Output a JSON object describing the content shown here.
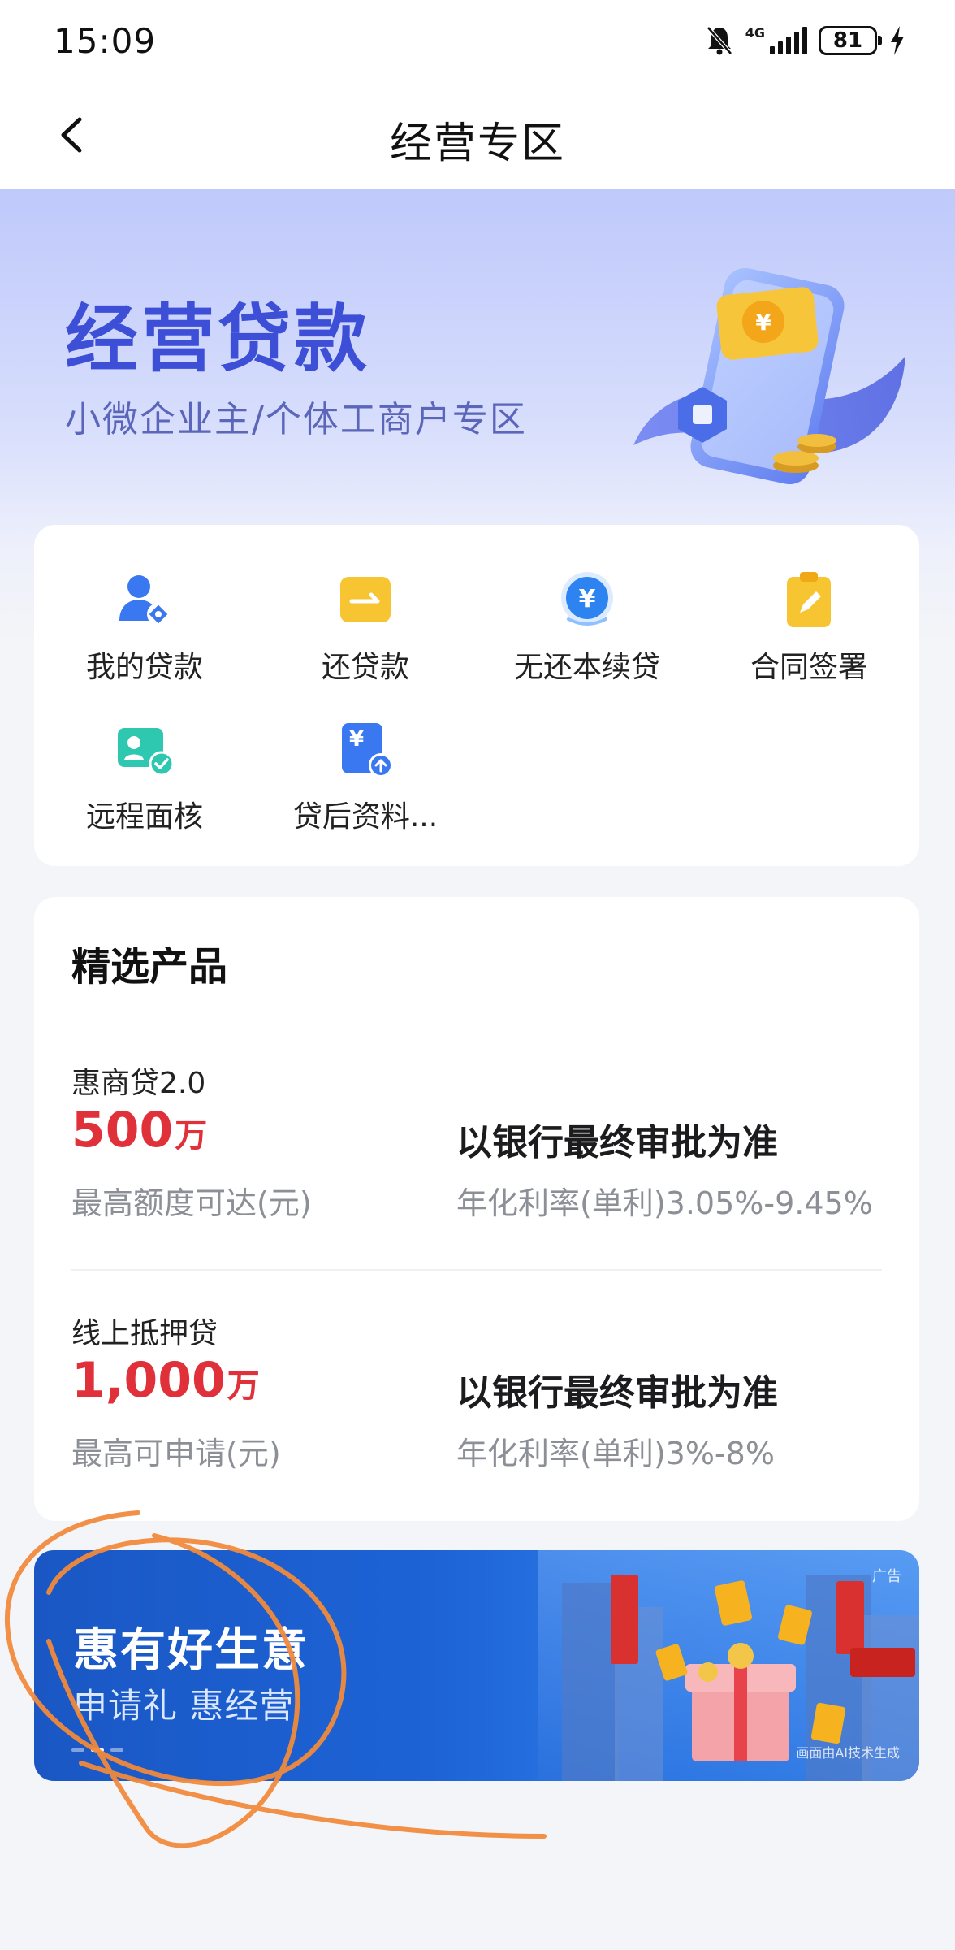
{
  "status_bar": {
    "time": "15:09",
    "network": "4G",
    "battery": "81"
  },
  "header": {
    "title": "经营专区"
  },
  "hero": {
    "title": "经营贷款",
    "subtitle": "小微企业主/个体工商户专区"
  },
  "quick_actions": [
    {
      "label": "我的贷款",
      "icon": "user-loan-icon"
    },
    {
      "label": "还贷款",
      "icon": "repay-icon"
    },
    {
      "label": "无还本续贷",
      "icon": "yuan-renew-icon"
    },
    {
      "label": "合同签署",
      "icon": "contract-sign-icon"
    },
    {
      "label": "远程面核",
      "icon": "remote-verify-icon"
    },
    {
      "label": "贷后资料...",
      "icon": "upload-document-icon"
    }
  ],
  "products": {
    "section_title": "精选产品",
    "items": [
      {
        "name": "惠商贷2.0",
        "amount": "500",
        "unit": "万",
        "amount_label": "最高额度可达(元)",
        "approval": "以银行最终审批为准",
        "rate": "年化利率(单利)3.05%-9.45%"
      },
      {
        "name": "线上抵押贷",
        "amount": "1,000",
        "unit": "万",
        "amount_label": "最高可申请(元)",
        "approval": "以银行最终审批为准",
        "rate": "年化利率(单利)3%-8%"
      }
    ]
  },
  "banner": {
    "title": "惠有好生意",
    "subtitle": "申请礼 惠经营",
    "ad_tag": "广告",
    "ai_note": "画面由AI技术生成"
  },
  "colors": {
    "accent": "#3d4fd6",
    "amount_red": "#e0303a",
    "banner_blue": "#1d63d6",
    "annotation_orange": "#f08a3c"
  }
}
